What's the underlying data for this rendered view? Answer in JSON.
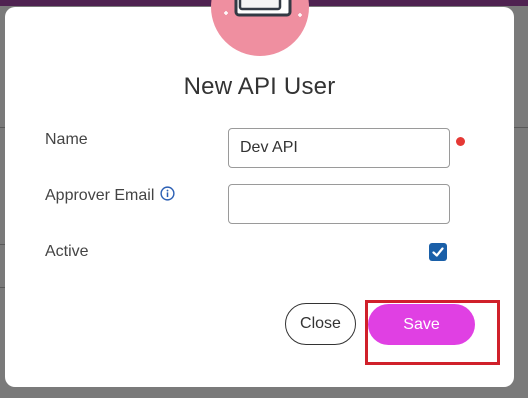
{
  "modal": {
    "title": "New API User",
    "fields": {
      "name_label": "Name",
      "name_value": "Dev API",
      "approver_email_label": "Approver Email",
      "approver_email_value": "",
      "active_label": "Active",
      "active_checked": true
    },
    "buttons": {
      "close_label": "Close",
      "save_label": "Save"
    }
  },
  "colors": {
    "save_button": "#e040e3",
    "required_indicator": "#e53935",
    "checkbox": "#1a5fa8",
    "highlight": "#d0202a",
    "illustration_circle": "#ef8fa0"
  },
  "icons": {
    "illustration": "document-clipboard-icon",
    "info": "info-circle-icon",
    "check": "checkmark-icon"
  }
}
